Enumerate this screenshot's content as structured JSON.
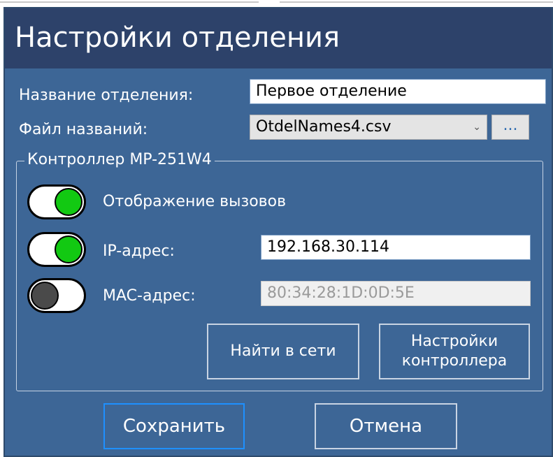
{
  "dialog": {
    "title": "Настройки отделения"
  },
  "form": {
    "department_name_label": "Название отделения:",
    "department_name_value": "Первое отделение",
    "names_file_label": "Файл названий:",
    "names_file_value": "OtdelNames4.csv",
    "browse_label": "..."
  },
  "controller": {
    "group_title": "Контроллер MP-251W4",
    "call_display": {
      "label": "Отображение вызовов",
      "on": true
    },
    "ip": {
      "label": "IP-адрес:",
      "on": true,
      "value": "192.168.30.114"
    },
    "mac": {
      "label": "MAC-адрес:",
      "on": false,
      "value": "80:34:28:1D:0D:5E"
    },
    "find_button": "Найти в сети",
    "settings_button_line1": "Настройки",
    "settings_button_line2": "контроллера"
  },
  "actions": {
    "save": "Сохранить",
    "cancel": "Отмена"
  },
  "colors": {
    "titlebar": "#2d426a",
    "dialog_bg": "#3d6696",
    "toggle_on": "#12c912",
    "toggle_off": "#4a4a4a",
    "focus_border": "#1e90ff"
  },
  "icons": {
    "dropdown": "chevron-down-icon"
  }
}
